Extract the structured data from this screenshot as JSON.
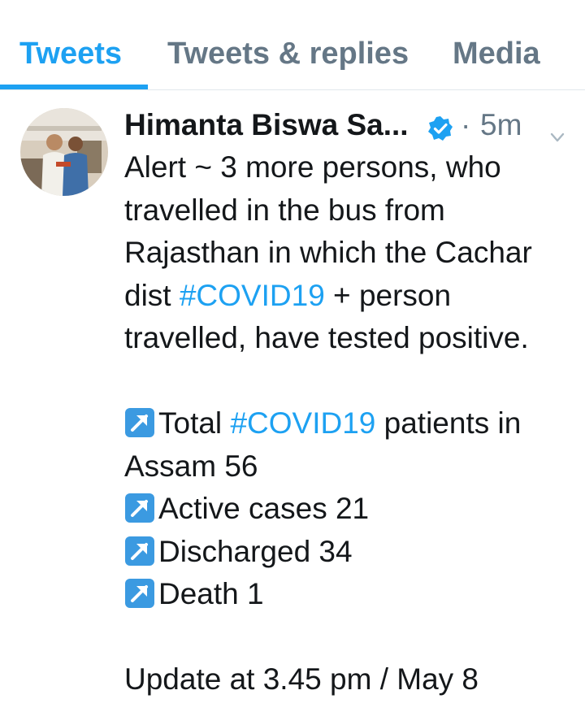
{
  "tabs": [
    {
      "label": "Tweets",
      "active": true
    },
    {
      "label": "Tweets & replies",
      "active": false
    },
    {
      "label": "Media",
      "active": false
    }
  ],
  "tweet": {
    "author_name": "Himanta Biswa Sa...",
    "verified": true,
    "separator": "·",
    "timestamp": "5m",
    "lines": {
      "l1": "Alert ~ 3 more persons, who",
      "l2": "travelled in the bus from",
      "l3": "Rajasthan in which the Cachar",
      "l4_pre": "dist ",
      "l4_tag": "#COVID19",
      "l4_post": " + person",
      "l5": "travelled, have tested positive.",
      "l6_pre": "Total ",
      "l6_tag": "#COVID19",
      "l6_post": " patients in",
      "l7": "Assam 56",
      "l8": "Active cases 21",
      "l9": "Discharged 34",
      "l10": "Death 1",
      "l11": "Update at 3.45 pm / May 8"
    }
  },
  "icons": {
    "verified": "verified-badge-icon",
    "caret": "chevron-down-icon",
    "bullet": "up-right-arrow-emoji-icon"
  },
  "colors": {
    "accent": "#1da1f2",
    "text": "#14171a",
    "muted": "#657786",
    "divider": "#e1e8ed"
  }
}
